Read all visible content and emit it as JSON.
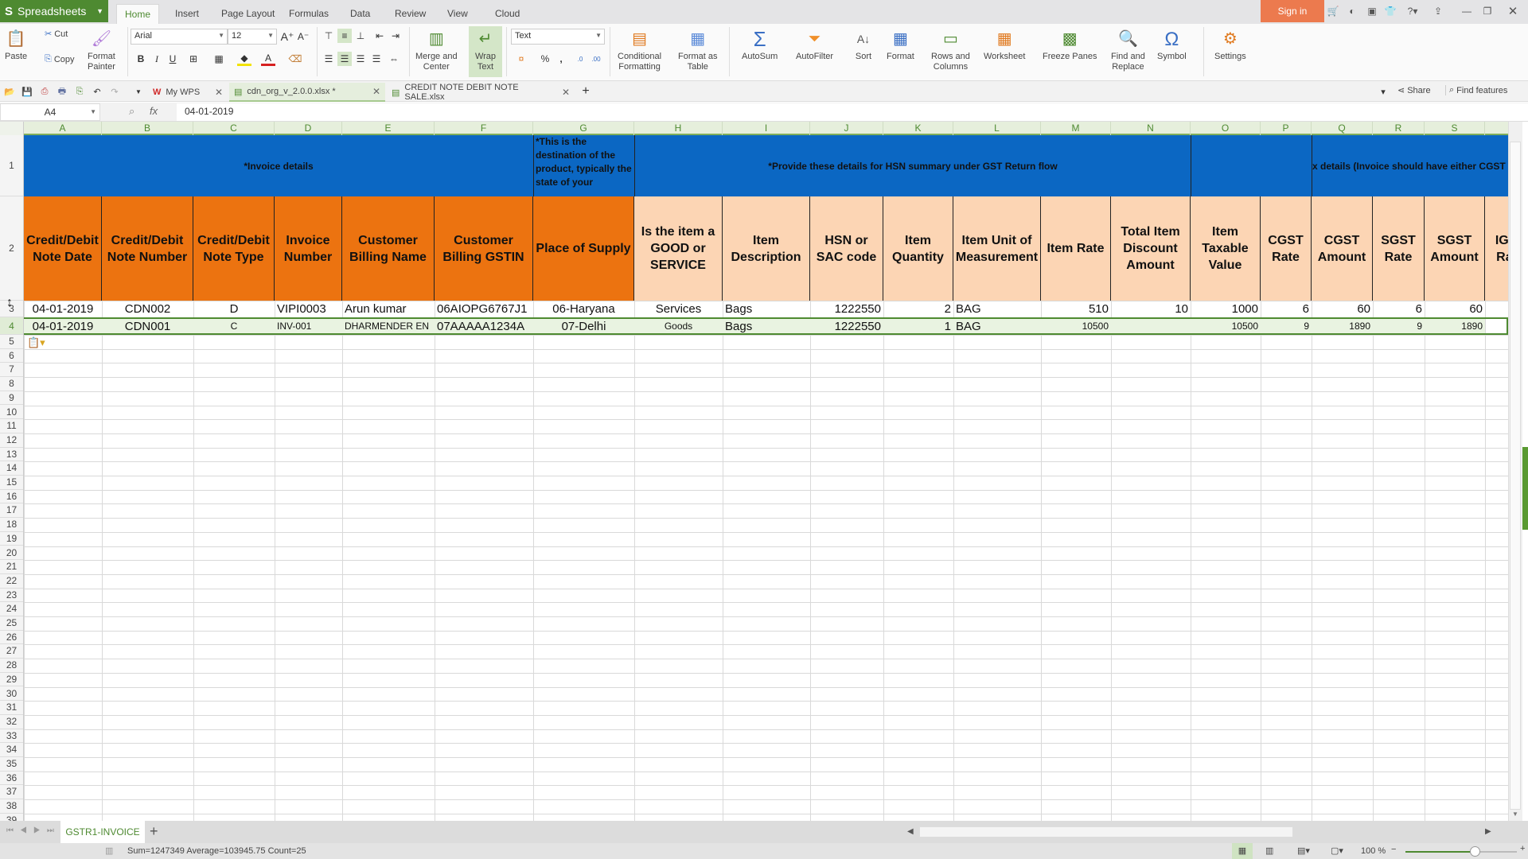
{
  "app": {
    "name": "Spreadsheets",
    "menu_tabs": [
      "Home",
      "Insert",
      "Page Layout",
      "Formulas",
      "Data",
      "Review",
      "View",
      "Cloud"
    ],
    "active_tab": "Home",
    "sign_in": "Sign in"
  },
  "ribbon": {
    "paste": "Paste",
    "cut": "Cut",
    "copy": "Copy",
    "format_painter_1": "Format",
    "format_painter_2": "Painter",
    "font_name": "Arial",
    "font_size": "12",
    "number_format": "Text",
    "merge_1": "Merge and",
    "merge_2": "Center",
    "wrap_1": "Wrap",
    "wrap_2": "Text",
    "cond_1": "Conditional",
    "cond_2": "Formatting",
    "fmt_table_1": "Format as",
    "fmt_table_2": "Table",
    "autosum": "AutoSum",
    "autofilter": "AutoFilter",
    "sort": "Sort",
    "format": "Format",
    "rows_cols_1": "Rows and",
    "rows_cols_2": "Columns",
    "worksheet": "Worksheet",
    "freeze": "Freeze Panes",
    "find_1": "Find and",
    "find_2": "Replace",
    "symbol": "Symbol",
    "settings": "Settings",
    "bold": "B",
    "italic": "I",
    "underline": "U",
    "percent": "%",
    "comma": ","
  },
  "doc_tabs": [
    {
      "label": "My WPS"
    },
    {
      "label": "cdn_org_v_2.0.0.xlsx *"
    },
    {
      "label": "CREDIT NOTE DEBIT NOTE SALE.xlsx"
    }
  ],
  "share": "Share",
  "find_features": "Find features",
  "formula_bar": {
    "cell_ref": "A4",
    "fx": "fx",
    "value": "04-01-2019"
  },
  "columns": [
    "A",
    "B",
    "C",
    "D",
    "E",
    "F",
    "G",
    "H",
    "I",
    "J",
    "K",
    "L",
    "M",
    "N",
    "O",
    "P",
    "Q",
    "R",
    "S"
  ],
  "row_numbers": [
    "1",
    "2",
    "3",
    "4",
    "5",
    "6",
    "7",
    "8",
    "9",
    "10",
    "11",
    "12",
    "13",
    "14",
    "15",
    "16",
    "17",
    "18",
    "19",
    "20",
    "21",
    "22",
    "23",
    "24",
    "25",
    "26",
    "27",
    "28",
    "29",
    "30",
    "31",
    "32",
    "33",
    "34",
    "35",
    "36",
    "37",
    "38",
    "39"
  ],
  "sheet": {
    "row1": {
      "invoice_details": "*Invoice details",
      "destination_note": "*This is the destination of the product, typically the state of your",
      "hsn_note": "*Provide these details for HSN summary under GST Return flow",
      "tax_note": "x details (Invoice should have either CGST & SGS"
    },
    "headers": [
      "Credit/Debit Note Date",
      "Credit/Debit Note Number",
      "Credit/Debit Note Type",
      "Invoice Number",
      "Customer Billing Name",
      "Customer Billing GSTIN",
      "Place of Supply",
      "Is the item a GOOD or SERVICE",
      "Item Description",
      "HSN or SAC code",
      "Item Quantity",
      "Item Unit of Measurement",
      "Item Rate",
      "Total Item Discount Amount",
      "Item Taxable Value",
      "CGST Rate",
      "CGST Amount",
      "SGST Rate",
      "SGST Amount",
      "IGST Rate"
    ],
    "rows": [
      [
        "04-01-2019",
        "CDN002",
        "D",
        "VIPI0003",
        "Arun kumar",
        "06AIOPG6767J1",
        "06-Haryana",
        "Services",
        "Bags",
        "1222550",
        "2",
        "BAG",
        "510",
        "10",
        "1000",
        "6",
        "60",
        "6",
        "60"
      ],
      [
        "04-01-2019",
        "CDN001",
        "C",
        "INV-001",
        "DHARMENDER EN",
        "07AAAAA1234A",
        "07-Delhi",
        "Goods",
        "Bags",
        "1222550",
        "1",
        "BAG",
        "10500",
        "",
        "10500",
        "9",
        "1890",
        "9",
        "1890"
      ]
    ]
  },
  "sheet_tabs": [
    "GSTR1-INVOICE"
  ],
  "status": {
    "summary": "Sum=1247349  Average=103945.75  Count=25",
    "zoom": "100 %",
    "zoom_fraction": 0.62
  }
}
